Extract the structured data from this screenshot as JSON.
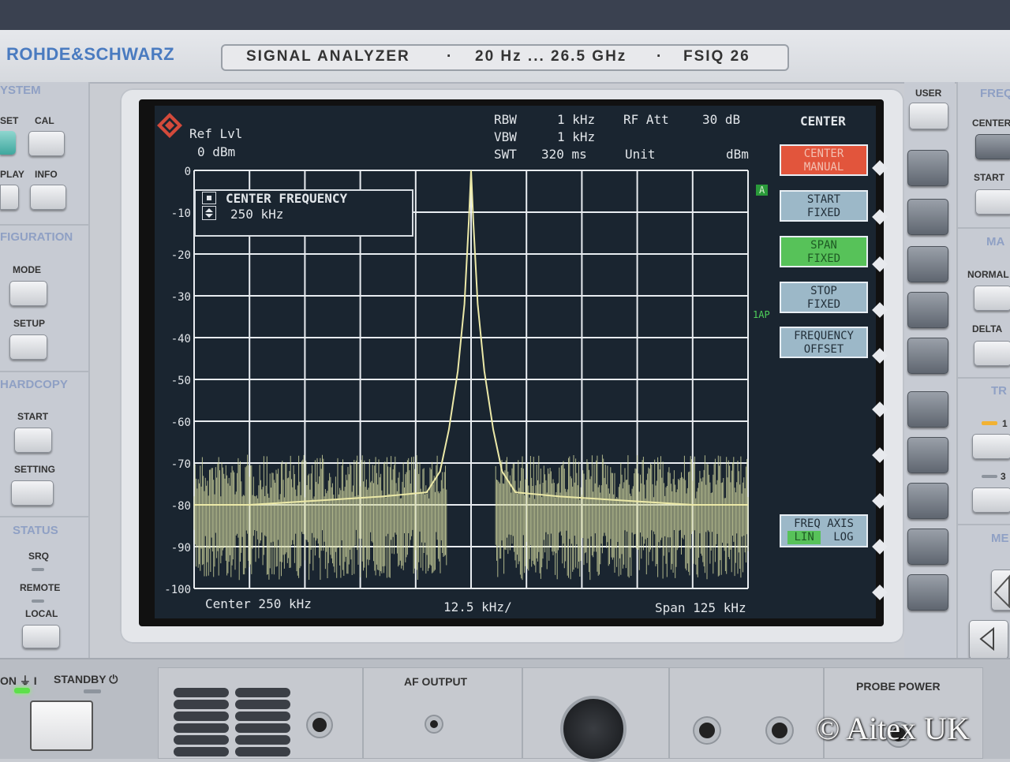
{
  "instrument": {
    "brand": "ROHDE&SCHWARZ",
    "model_plate": {
      "name": "SIGNAL ANALYZER",
      "sep1": "·",
      "range": "20 Hz ... 26.5 GHz",
      "sep2": "·",
      "model": "FSIQ 26"
    }
  },
  "left_panel": {
    "system": {
      "header": "YSTEM",
      "buttons": [
        "SET",
        "CAL",
        "PLAY",
        "INFO"
      ]
    },
    "configuration": {
      "header": "FIGURATION",
      "buttons": [
        "MODE",
        "SETUP"
      ]
    },
    "hardcopy": {
      "header": "HARDCOPY",
      "buttons": [
        "START",
        "SETTING"
      ]
    },
    "status": {
      "header": "STATUS",
      "leds": [
        "SRQ",
        "REMOTE"
      ],
      "local_button": "LOCAL"
    }
  },
  "power": {
    "on_label": "ON",
    "on_symbol": "⏚ I",
    "standby_label": "STANDBY",
    "standby_symbol": "⏻"
  },
  "screen": {
    "ref_level_label": "Ref Lvl",
    "ref_level_value": "0 dBm",
    "settings": {
      "rbw_label": "RBW",
      "rbw_value": "1 kHz",
      "vbw_label": "VBW",
      "vbw_value": "1 kHz",
      "swt_label": "SWT",
      "swt_value": "320 ms",
      "rf_att_label": "RF Att",
      "rf_att_value": "30 dB",
      "unit_label": "Unit",
      "unit_value": "dBm"
    },
    "entry_box": {
      "title": "CENTER FREQUENCY",
      "value": "250 kHz"
    },
    "y_ticks": [
      "0",
      "-10",
      "-20",
      "-30",
      "-40",
      "-50",
      "-60",
      "-70",
      "-80",
      "-90",
      "-100"
    ],
    "markers": {
      "trace_a": "A",
      "trace_mode": "1AP"
    },
    "footer": {
      "center": "Center 250 kHz",
      "div": "12.5 kHz/",
      "span": "Span 125 kHz"
    }
  },
  "softkeys": {
    "menu_title": "CENTER",
    "keys": [
      {
        "line1": "CENTER",
        "line2": "MANUAL",
        "state": "red"
      },
      {
        "line1": "START",
        "line2": "FIXED",
        "state": "blue"
      },
      {
        "line1": "SPAN",
        "line2": "FIXED",
        "state": "green"
      },
      {
        "line1": "STOP",
        "line2": "FIXED",
        "state": "blue"
      },
      {
        "line1": "FREQUENCY",
        "line2": "OFFSET",
        "state": "blue"
      }
    ],
    "freq_axis": {
      "line1": "FREQ AXIS",
      "lin": "LIN",
      "log": "LOG",
      "selected": "LIN"
    }
  },
  "right_panel": {
    "user_label": "USER",
    "freq_header": "FREQ",
    "freq_buttons": [
      "CENTER",
      "START"
    ],
    "marker_header": "MA",
    "marker_buttons": [
      "NORMAL",
      "DELTA"
    ],
    "trace_header": "TR",
    "trace_numbers": [
      "1",
      "3"
    ],
    "meas_header": "ME"
  },
  "bottom_panel": {
    "af_output": "AF OUTPUT",
    "probe_power": "PROBE POWER"
  },
  "watermark": "© Aitex UK",
  "chart_data": {
    "type": "line",
    "x_unit": "kHz",
    "y_unit": "dBm",
    "xlim": [
      187.5,
      312.5
    ],
    "ylim": [
      -100,
      0
    ],
    "center_khz": 250,
    "span_khz": 125,
    "x_div_khz": 12.5,
    "grid": true,
    "series": [
      {
        "x": [
          187.5,
          200,
          215,
          230,
          240,
          243,
          245,
          247,
          248.5,
          249.5,
          250,
          250.5,
          251.5,
          253,
          255,
          257,
          260,
          270,
          285,
          300,
          312.5
        ],
        "y": [
          -80,
          -80,
          -79,
          -78,
          -77,
          -72,
          -62,
          -48,
          -32,
          -12,
          0,
          -12,
          -32,
          -48,
          -62,
          -72,
          -77,
          -78,
          -79,
          -80,
          -80
        ]
      }
    ],
    "noise_floor_dbm": [
      -86,
      -68
    ]
  }
}
